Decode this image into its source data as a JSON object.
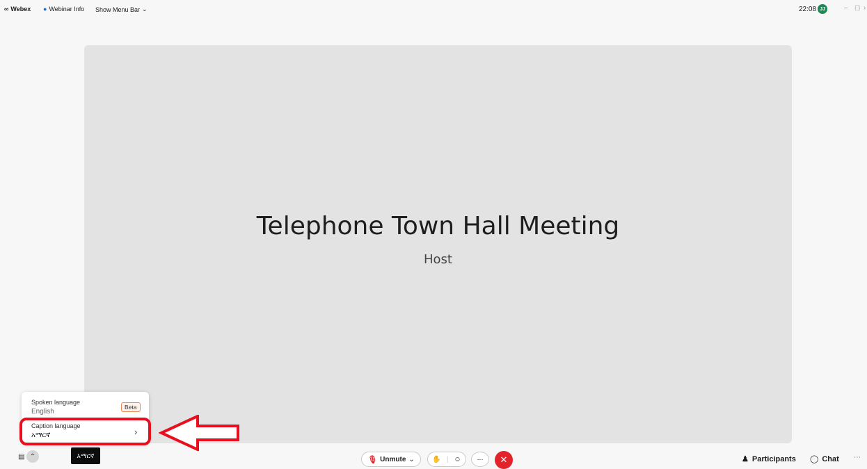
{
  "topbar": {
    "app_name": "Webex",
    "webinar_info": "Webinar Info",
    "show_menu_bar": "Show Menu Bar",
    "time": "22:08",
    "avatar_initial": "JJ",
    "icons": {
      "logo": "webex-logo-icon",
      "info": "shield-icon",
      "chevron": "chevron-down-icon"
    }
  },
  "stage": {
    "title": "Telephone Town Hall Meeting",
    "subtitle": "Host"
  },
  "caption_menu": {
    "spoken_label": "Spoken language",
    "spoken_value": "English",
    "beta_badge": "Beta",
    "caption_label": "Caption language",
    "caption_value": "አማርኛ"
  },
  "bottombar": {
    "caption_chip": "አማርኛ",
    "unmute_label": "Unmute",
    "participants_label": "Participants",
    "chat_label": "Chat",
    "colors": {
      "danger": "#e3232a",
      "highlight": "#e8101e",
      "accent_green": "#1d8a54"
    }
  }
}
